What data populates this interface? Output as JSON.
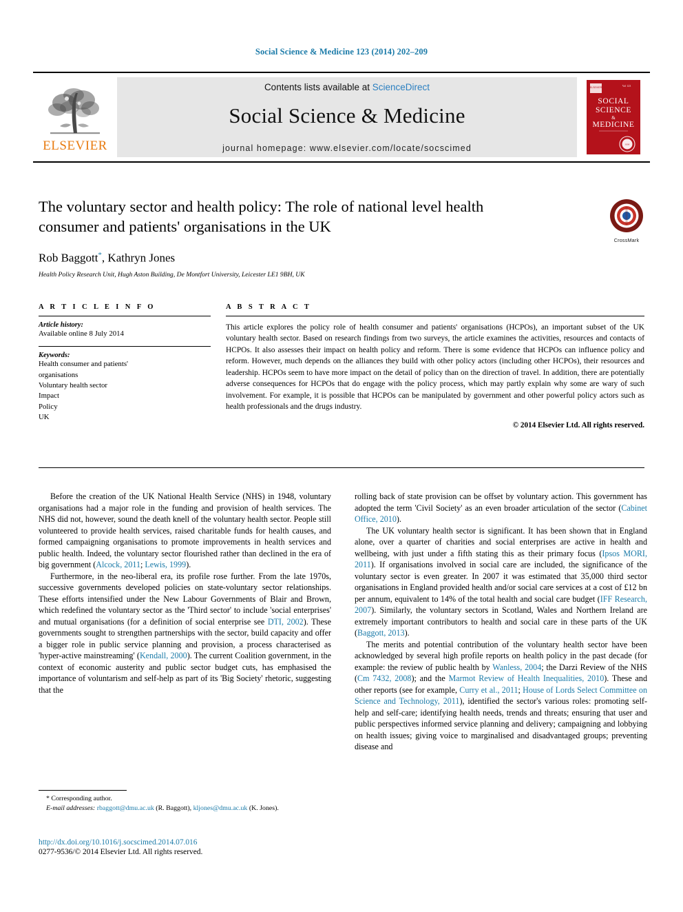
{
  "running_head": "Social Science & Medicine 123 (2014) 202–209",
  "masthead": {
    "contents_prefix": "Contents lists available at ",
    "sciencedirect": "ScienceDirect",
    "journal_title": "Social Science & Medicine",
    "homepage": "journal homepage: www.elsevier.com/locate/socscimed",
    "elsevier_wordmark": "ELSEVIER",
    "cover_title_line1": "SOCIAL",
    "cover_title_line2": "SCIENCE",
    "cover_title_line3": "&",
    "cover_title_line4": "MEDICINE"
  },
  "article": {
    "title": "The voluntary sector and health policy: The role of national level health consumer and patients' organisations in the UK",
    "authors": "Rob Baggott",
    "author_marker": "*",
    "authors_rest": ", Kathryn Jones",
    "affiliation": "Health Policy Research Unit, Hugh Aston Building, De Montfort University, Leicester LE1 9BH, UK",
    "crossmark_label": "CrossMark"
  },
  "info": {
    "heading": "A R T I C L E   I N F O",
    "history_label": "Article history:",
    "history_value": "Available online 8 July 2014",
    "keywords_label": "Keywords:",
    "keywords": [
      "Health consumer and patients'",
      "organisations",
      "Voluntary health sector",
      "Impact",
      "Policy",
      "UK"
    ]
  },
  "abstract": {
    "heading": "A B S T R A C T",
    "text": "This article explores the policy role of health consumer and patients' organisations (HCPOs), an important subset of the UK voluntary health sector. Based on research findings from two surveys, the article examines the activities, resources and contacts of HCPOs. It also assesses their impact on health policy and reform. There is some evidence that HCPOs can influence policy and reform. However, much depends on the alliances they build with other policy actors (including other HCPOs), their resources and leadership. HCPOs seem to have more impact on the detail of policy than on the direction of travel. In addition, there are potentially adverse consequences for HCPOs that do engage with the policy process, which may partly explain why some are wary of such involvement. For example, it is possible that HCPOs can be manipulated by government and other powerful policy actors such as health professionals and the drugs industry.",
    "copyright": "© 2014 Elsevier Ltd. All rights reserved."
  },
  "body": {
    "left": {
      "p1_a": "Before the creation of the UK National Health Service (NHS) in 1948, voluntary organisations had a major role in the funding and provision of health services. The NHS did not, however, sound the death knell of the voluntary health sector. People still volunteered to provide health services, raised charitable funds for health causes, and formed campaigning organisations to promote improvements in health services and public health. Indeed, the voluntary sector flourished rather than declined in the era of big government (",
      "p1_ref1": "Alcock, 2011",
      "p1_sep1": "; ",
      "p1_ref2": "Lewis, 1999",
      "p1_b": ").",
      "p2_a": "Furthermore, in the neo-liberal era, its profile rose further. From the late 1970s, successive governments developed policies on state-voluntary sector relationships. These efforts intensified under the New Labour Governments of Blair and Brown, which redefined the voluntary sector as the 'Third sector' to include 'social enterprises' and mutual organisations (for a definition of social enterprise see ",
      "p2_ref1": "DTI, 2002",
      "p2_b": "). These governments sought to strengthen partnerships with the sector, build capacity and offer a bigger role in public service planning and provision, a process characterised as 'hyper-active mainstreaming' (",
      "p2_ref2": "Kendall, 2000",
      "p2_c": "). The current Coalition government, in the context of economic austerity and public sector budget cuts, has emphasised the importance of voluntarism and self-help as part of its 'Big Society' rhetoric, suggesting that the"
    },
    "right": {
      "p1_a": "rolling back of state provision can be offset by voluntary action. This government has adopted the term 'Civil Society' as an even broader articulation of the sector (",
      "p1_ref1": "Cabinet Office, 2010",
      "p1_b": ").",
      "p2_a": "The UK voluntary health sector is significant. It has been shown that in England alone, over a quarter of charities and social enterprises are active in health and wellbeing, with just under a fifth stating this as their primary focus (",
      "p2_ref1": "Ipsos MORI, 2011",
      "p2_b": "). If organisations involved in social care are included, the significance of the voluntary sector is even greater. In 2007 it was estimated that 35,000 third sector organisations in England provided health and/or social care services at a cost of £12 bn per annum, equivalent to 14% of the total health and social care budget (",
      "p2_ref2": "IFF Research, 2007",
      "p2_c": "). Similarly, the voluntary sectors in Scotland, Wales and Northern Ireland are extremely important contributors to health and social care in these parts of the UK (",
      "p2_ref3": "Baggott, 2013",
      "p2_d": ").",
      "p3_a": "The merits and potential contribution of the voluntary health sector have been acknowledged by several high profile reports on health policy in the past decade (for example: the review of public health by ",
      "p3_ref1": "Wanless, 2004",
      "p3_b": "; the Darzi Review of the NHS (",
      "p3_ref2": "Cm 7432, 2008",
      "p3_c": "); and the ",
      "p3_ref3": "Marmot Review of Health Inequalities, 2010",
      "p3_d": "). These and other reports (see for example, ",
      "p3_ref4": "Curry et al., 2011",
      "p3_sep": "; ",
      "p3_ref5": "House of Lords Select Committee on Science and Technology, 2011",
      "p3_e": "), identified the sector's various roles: promoting self-help and self-care; identifying health needs, trends and threats; ensuring that user and public perspectives informed service planning and delivery; campaigning and lobbying on health issues; giving voice to marginalised and disadvantaged groups; preventing disease and"
    }
  },
  "footnote": {
    "corresponding": "Corresponding author.",
    "email_label": "E-mail addresses:",
    "email1": "rbaggott@dmu.ac.uk",
    "email1_name": "(R. Baggott)",
    "email2": "kljones@dmu.ac.uk",
    "email2_name": "(K. Jones)."
  },
  "doi": {
    "url": "http://dx.doi.org/10.1016/j.socscimed.2014.07.016",
    "issn_line": "0277-9536/© 2014 Elsevier Ltd. All rights reserved."
  },
  "colors": {
    "link": "#1a7aa8",
    "elsevier_orange": "#E87B10",
    "cover_red": "#B4121B",
    "masthead_gray": "#e6e6e6"
  }
}
